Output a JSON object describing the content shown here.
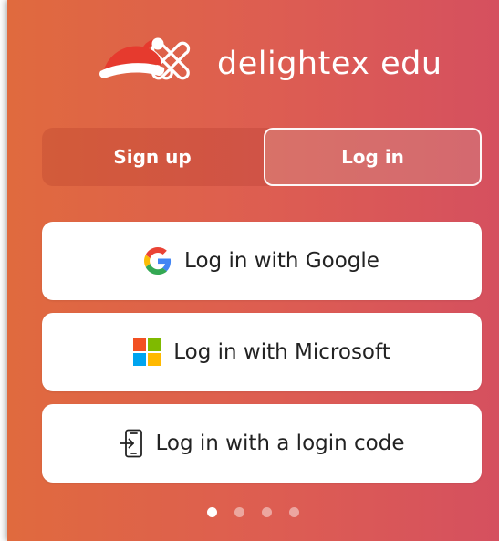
{
  "brand": {
    "name": "delightex edu"
  },
  "tabs": {
    "signup": "Sign up",
    "login": "Log in",
    "active": "login"
  },
  "buttons": {
    "google": "Log in with Google",
    "microsoft": "Log in with Microsoft",
    "code": "Log in with a login code"
  },
  "icons": {
    "google": "google-g-icon",
    "microsoft": "microsoft-logo-icon",
    "code": "login-code-icon",
    "logo": "santa-hat-logo-icon"
  },
  "carousel": {
    "count": 4,
    "active": 1
  },
  "colors": {
    "gradient_start": "#e06a3e",
    "gradient_end": "#d5505f",
    "button_bg": "#ffffff",
    "microsoft_red": "#f25022",
    "microsoft_green": "#7fba00",
    "microsoft_blue": "#00a4ef",
    "microsoft_yellow": "#ffb900"
  }
}
